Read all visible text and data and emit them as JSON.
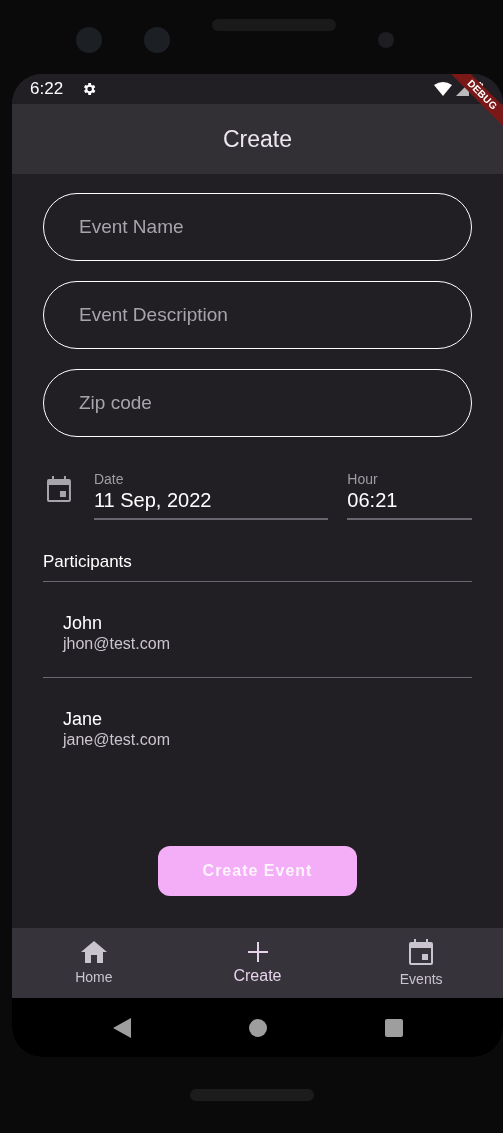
{
  "status_bar": {
    "time": "6:22"
  },
  "debug_banner": "DEBUG",
  "app_bar": {
    "title": "Create"
  },
  "fields": [
    {
      "placeholder": "Event Name"
    },
    {
      "placeholder": "Event Description"
    },
    {
      "placeholder": "Zip code"
    }
  ],
  "date": {
    "label": "Date",
    "value": "11 Sep, 2022"
  },
  "hour": {
    "label": "Hour",
    "value": "06:21"
  },
  "participants": {
    "title": "Participants",
    "items": [
      {
        "name": "John",
        "email": "jhon@test.com"
      },
      {
        "name": "Jane",
        "email": "jane@test.com"
      }
    ]
  },
  "button": "Create Event",
  "bottom_nav": [
    {
      "label": "Home",
      "kind": "home",
      "selected": false
    },
    {
      "label": "Create",
      "kind": "add",
      "selected": true
    },
    {
      "label": "Events",
      "kind": "events",
      "selected": false
    }
  ]
}
